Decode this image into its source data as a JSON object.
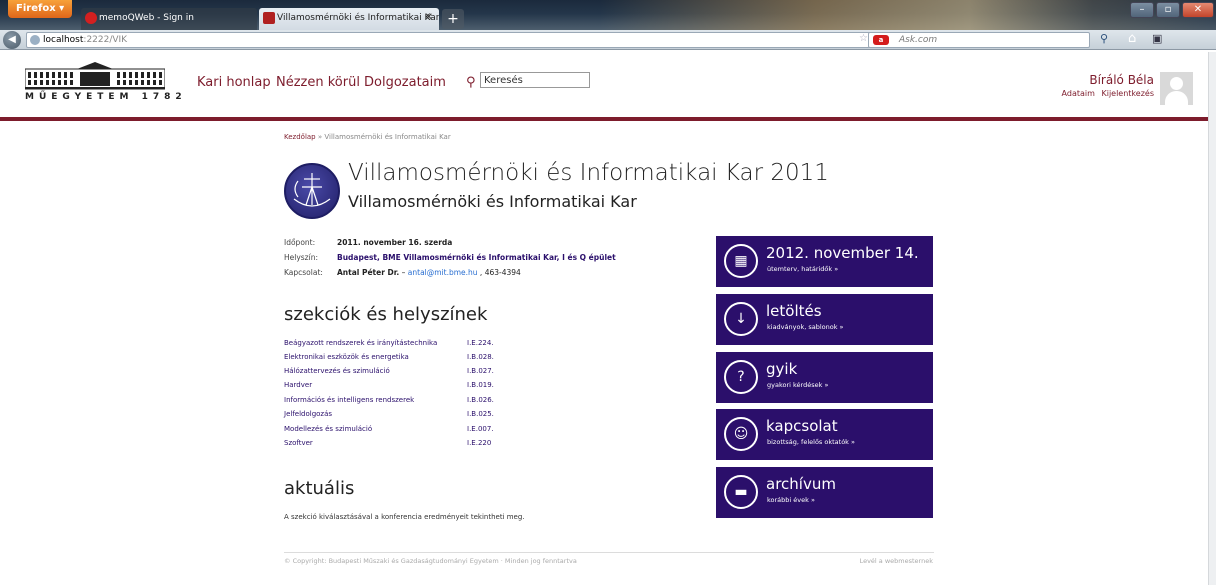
{
  "browser": {
    "app_button": "Firefox",
    "tabs": [
      {
        "label": "memoQWeb - Sign in"
      },
      {
        "label": "Villamosmérnöki és Informatikai Kar -..."
      }
    ],
    "new_tab": "+",
    "url_host": "localhost",
    "url_rest": ":2222/VIK",
    "search_engine": "Ask.com"
  },
  "header": {
    "logo_text": "MŰEGYETEM 1782",
    "nav": [
      "Kari honlap",
      "Nézzen körül",
      "Dolgozataim"
    ],
    "search_value": "Keresés",
    "user_name": "Bíráló Béla",
    "user_links": [
      "Adataim",
      "Kijelentkezés"
    ]
  },
  "content": {
    "breadcrumb_home": "Kezdőlap",
    "breadcrumb_rest": " » Villamosmérnöki és Informatikai Kar",
    "title": "Villamosmérnöki és Informatikai Kar 2011",
    "subtitle": "Villamosmérnöki és Informatikai Kar",
    "info": {
      "idopont_label": "Időpont:",
      "idopont_value": "2011. november 16. szerda",
      "helyszin_label": "Helyszín:",
      "helyszin_value": "Budapest, BME Villamosmérnöki és Informatikai Kar, I és Q épület",
      "kapcsolat_label": "Kapcsolat:",
      "kapcsolat_name": "Antal Péter Dr.",
      "kapcsolat_sep": " – ",
      "kapcsolat_email": "antal@mit.bme.hu",
      "kapcsolat_phone": " , 463-4394"
    },
    "sections_heading": "szekciók és helyszínek",
    "sections": [
      {
        "name": "Beágyazott rendszerek és irányítástechnika",
        "room": "I.E.224."
      },
      {
        "name": "Elektronikai eszközök és energetika",
        "room": "I.B.028."
      },
      {
        "name": "Hálózattervezés és szimuláció",
        "room": "I.B.027."
      },
      {
        "name": "Hardver",
        "room": "I.B.019."
      },
      {
        "name": "Információs és intelligens rendszerek",
        "room": "I.B.026."
      },
      {
        "name": "Jelfeldolgozás",
        "room": "I.B.025."
      },
      {
        "name": "Modellezés és szimuláció",
        "room": "I.E.007."
      },
      {
        "name": "Szoftver",
        "room": "I.E.220"
      }
    ],
    "aktualis_heading": "aktuális",
    "aktualis_text": "A szekció kiválasztásával a konferencia eredményeit tekintheti meg."
  },
  "tiles": [
    {
      "title": "2012. november 14.",
      "subtitle": "ütemterv, határidők »",
      "icon": "calendar-icon"
    },
    {
      "title": "letöltés",
      "subtitle": "kiadványok, sablonok »",
      "icon": "download-icon"
    },
    {
      "title": "gyik",
      "subtitle": "gyakori kérdések »",
      "icon": "question-icon"
    },
    {
      "title": "kapcsolat",
      "subtitle": "bizottság, felelős oktatók »",
      "icon": "people-icon"
    },
    {
      "title": "archívum",
      "subtitle": "korábbi évek »",
      "icon": "folder-icon"
    }
  ],
  "footer": {
    "copyright": "© Copyright: Budapesti Műszaki és Gazdaságtudományi Egyetem · Minden jog fenntartva",
    "mail": "Levél a webmesternek"
  },
  "colors": {
    "accent": "#7d1c2c",
    "tile": "#2b0f6b"
  }
}
